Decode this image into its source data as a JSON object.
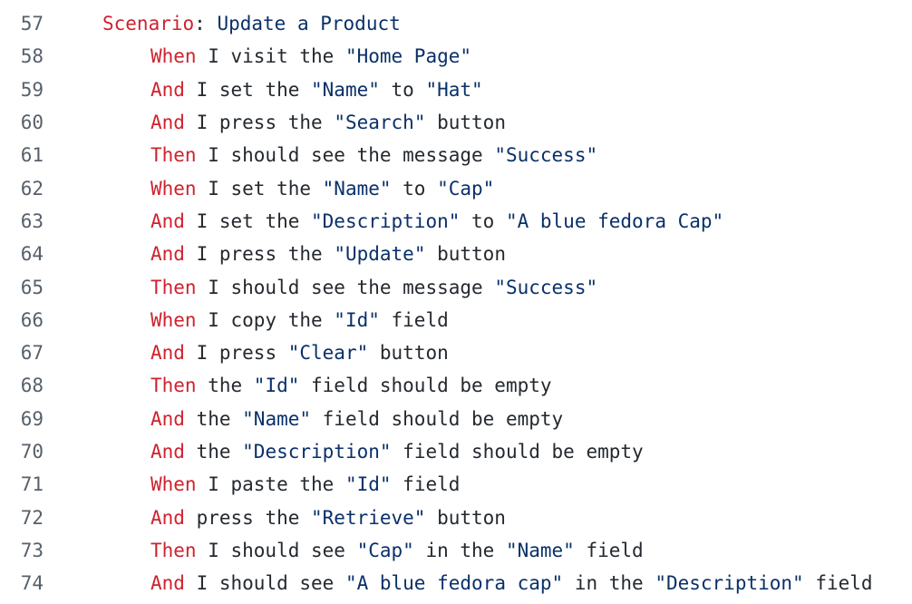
{
  "lines": [
    {
      "num": "57",
      "indent": 1,
      "tokens": [
        {
          "t": "keyword",
          "v": "Scenario"
        },
        {
          "t": "plain",
          "v": ": "
        },
        {
          "t": "string",
          "v": "Update a Product"
        }
      ]
    },
    {
      "num": "58",
      "indent": 2,
      "tokens": [
        {
          "t": "keyword",
          "v": "When"
        },
        {
          "t": "plain",
          "v": " I visit the "
        },
        {
          "t": "string",
          "v": "\"Home Page\""
        }
      ]
    },
    {
      "num": "59",
      "indent": 2,
      "tokens": [
        {
          "t": "keyword",
          "v": "And"
        },
        {
          "t": "plain",
          "v": " I set the "
        },
        {
          "t": "string",
          "v": "\"Name\""
        },
        {
          "t": "plain",
          "v": " to "
        },
        {
          "t": "string",
          "v": "\"Hat\""
        }
      ]
    },
    {
      "num": "60",
      "indent": 2,
      "tokens": [
        {
          "t": "keyword",
          "v": "And"
        },
        {
          "t": "plain",
          "v": " I press the "
        },
        {
          "t": "string",
          "v": "\"Search\""
        },
        {
          "t": "plain",
          "v": " button"
        }
      ]
    },
    {
      "num": "61",
      "indent": 2,
      "tokens": [
        {
          "t": "keyword",
          "v": "Then"
        },
        {
          "t": "plain",
          "v": " I should see the message "
        },
        {
          "t": "string",
          "v": "\"Success\""
        }
      ]
    },
    {
      "num": "62",
      "indent": 2,
      "tokens": [
        {
          "t": "keyword",
          "v": "When"
        },
        {
          "t": "plain",
          "v": " I set the "
        },
        {
          "t": "string",
          "v": "\"Name\""
        },
        {
          "t": "plain",
          "v": " to "
        },
        {
          "t": "string",
          "v": "\"Cap\""
        }
      ]
    },
    {
      "num": "63",
      "indent": 2,
      "tokens": [
        {
          "t": "keyword",
          "v": "And"
        },
        {
          "t": "plain",
          "v": " I set the "
        },
        {
          "t": "string",
          "v": "\"Description\""
        },
        {
          "t": "plain",
          "v": " to "
        },
        {
          "t": "string",
          "v": "\"A blue fedora Cap\""
        }
      ]
    },
    {
      "num": "64",
      "indent": 2,
      "tokens": [
        {
          "t": "keyword",
          "v": "And"
        },
        {
          "t": "plain",
          "v": " I press the "
        },
        {
          "t": "string",
          "v": "\"Update\""
        },
        {
          "t": "plain",
          "v": " button"
        }
      ]
    },
    {
      "num": "65",
      "indent": 2,
      "tokens": [
        {
          "t": "keyword",
          "v": "Then"
        },
        {
          "t": "plain",
          "v": " I should see the message "
        },
        {
          "t": "string",
          "v": "\"Success\""
        }
      ]
    },
    {
      "num": "66",
      "indent": 2,
      "tokens": [
        {
          "t": "keyword",
          "v": "When"
        },
        {
          "t": "plain",
          "v": " I copy the "
        },
        {
          "t": "string",
          "v": "\"Id\""
        },
        {
          "t": "plain",
          "v": " field"
        }
      ]
    },
    {
      "num": "67",
      "indent": 2,
      "tokens": [
        {
          "t": "keyword",
          "v": "And"
        },
        {
          "t": "plain",
          "v": " I press "
        },
        {
          "t": "string",
          "v": "\"Clear\""
        },
        {
          "t": "plain",
          "v": " button"
        }
      ]
    },
    {
      "num": "68",
      "indent": 2,
      "tokens": [
        {
          "t": "keyword",
          "v": "Then"
        },
        {
          "t": "plain",
          "v": " the "
        },
        {
          "t": "string",
          "v": "\"Id\""
        },
        {
          "t": "plain",
          "v": " field should be empty"
        }
      ]
    },
    {
      "num": "69",
      "indent": 2,
      "tokens": [
        {
          "t": "keyword",
          "v": "And"
        },
        {
          "t": "plain",
          "v": " the "
        },
        {
          "t": "string",
          "v": "\"Name\""
        },
        {
          "t": "plain",
          "v": " field should be empty"
        }
      ]
    },
    {
      "num": "70",
      "indent": 2,
      "tokens": [
        {
          "t": "keyword",
          "v": "And"
        },
        {
          "t": "plain",
          "v": " the "
        },
        {
          "t": "string",
          "v": "\"Description\""
        },
        {
          "t": "plain",
          "v": " field should be empty"
        }
      ]
    },
    {
      "num": "71",
      "indent": 2,
      "tokens": [
        {
          "t": "keyword",
          "v": "When"
        },
        {
          "t": "plain",
          "v": " I paste the "
        },
        {
          "t": "string",
          "v": "\"Id\""
        },
        {
          "t": "plain",
          "v": " field"
        }
      ]
    },
    {
      "num": "72",
      "indent": 2,
      "tokens": [
        {
          "t": "keyword",
          "v": "And"
        },
        {
          "t": "plain",
          "v": " press the "
        },
        {
          "t": "string",
          "v": "\"Retrieve\""
        },
        {
          "t": "plain",
          "v": " button"
        }
      ]
    },
    {
      "num": "73",
      "indent": 2,
      "tokens": [
        {
          "t": "keyword",
          "v": "Then"
        },
        {
          "t": "plain",
          "v": " I should see "
        },
        {
          "t": "string",
          "v": "\"Cap\""
        },
        {
          "t": "plain",
          "v": " in the "
        },
        {
          "t": "string",
          "v": "\"Name\""
        },
        {
          "t": "plain",
          "v": " field"
        }
      ]
    },
    {
      "num": "74",
      "indent": 2,
      "tokens": [
        {
          "t": "keyword",
          "v": "And"
        },
        {
          "t": "plain",
          "v": " I should see "
        },
        {
          "t": "string",
          "v": "\"A blue fedora cap\""
        },
        {
          "t": "plain",
          "v": " in the "
        },
        {
          "t": "string",
          "v": "\"Description\""
        },
        {
          "t": "plain",
          "v": " field"
        }
      ]
    }
  ],
  "colors": {
    "keyword": "#cf222e",
    "string": "#0a3069",
    "plain": "#24292f",
    "line_number": "#57606a",
    "background": "#ffffff"
  }
}
